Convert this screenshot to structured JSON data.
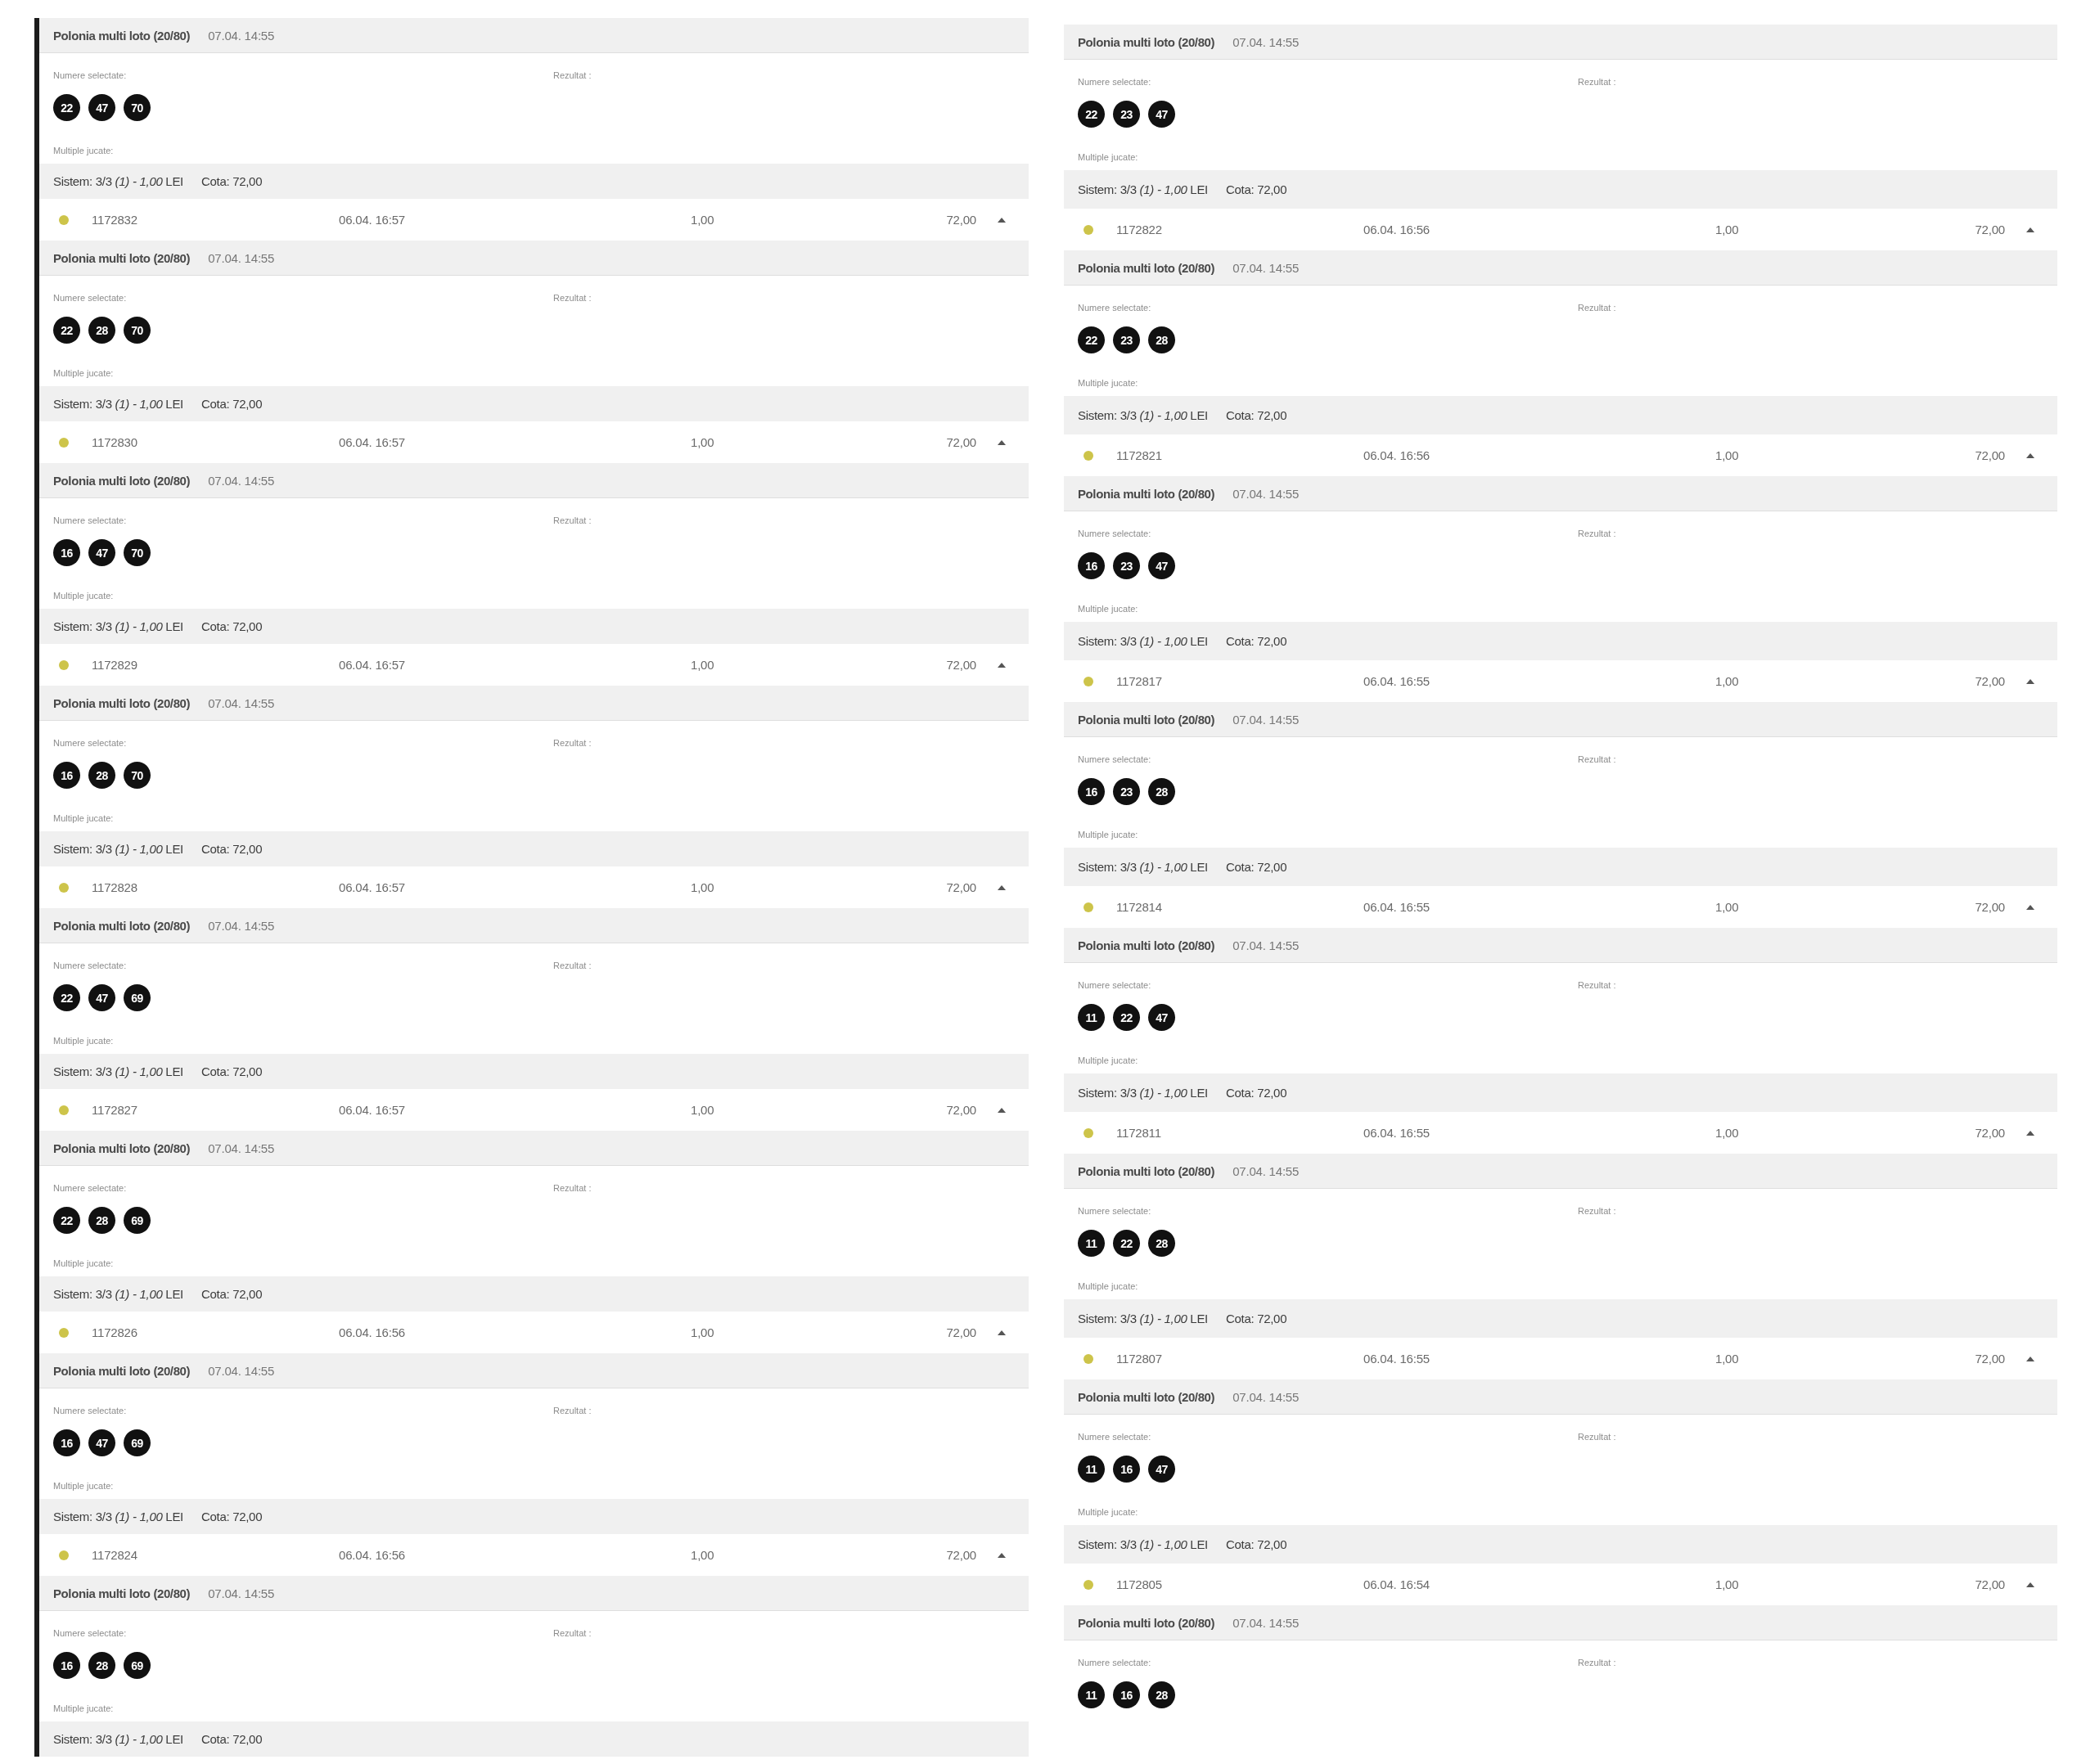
{
  "panels": [
    {
      "tickets": [
        {
          "details": {
            "game": "Polonia multi loto (20/80)",
            "draw_time": "07.04. 14:55",
            "numbers_label": "Numere selectate:",
            "numbers": [
              "22",
              "47",
              "70"
            ],
            "result_label": "Rezultat :",
            "multiples_label": "Multiple jucate:",
            "system": {
              "text": "Sistem: 3/3 *(1) - 1,00* LEI",
              "odds": "Cota: 72,00"
            }
          }
        },
        {
          "row": {
            "color": "#cdc44a",
            "id": "1172832",
            "time": "06.04. 16:57",
            "stake": "1,00",
            "win": "72,00",
            "expanded": true
          },
          "details": {
            "game": "Polonia multi loto (20/80)",
            "draw_time": "07.04. 14:55",
            "numbers_label": "Numere selectate:",
            "numbers": [
              "22",
              "28",
              "70"
            ],
            "result_label": "Rezultat :",
            "multiples_label": "Multiple jucate:",
            "system": {
              "text": "Sistem: 3/3 *(1) - 1,00* LEI",
              "odds": "Cota: 72,00"
            }
          }
        },
        {
          "row": {
            "color": "#cdc44a",
            "id": "1172830",
            "time": "06.04. 16:57",
            "stake": "1,00",
            "win": "72,00",
            "expanded": true
          },
          "details": {
            "game": "Polonia multi loto (20/80)",
            "draw_time": "07.04. 14:55",
            "numbers_label": "Numere selectate:",
            "numbers": [
              "16",
              "47",
              "70"
            ],
            "result_label": "Rezultat :",
            "multiples_label": "Multiple jucate:",
            "system": {
              "text": "Sistem: 3/3 *(1) - 1,00* LEI",
              "odds": "Cota: 72,00"
            }
          }
        },
        {
          "row": {
            "color": "#cdc44a",
            "id": "1172829",
            "time": "06.04. 16:57",
            "stake": "1,00",
            "win": "72,00",
            "expanded": true
          },
          "details": {
            "game": "Polonia multi loto (20/80)",
            "draw_time": "07.04. 14:55",
            "numbers_label": "Numere selectate:",
            "numbers": [
              "16",
              "28",
              "70"
            ],
            "result_label": "Rezultat :",
            "multiples_label": "Multiple jucate:",
            "system": {
              "text": "Sistem: 3/3 *(1) - 1,00* LEI",
              "odds": "Cota: 72,00"
            }
          }
        },
        {
          "row": {
            "color": "#cdc44a",
            "id": "1172828",
            "time": "06.04. 16:57",
            "stake": "1,00",
            "win": "72,00",
            "expanded": true
          },
          "details": {
            "game": "Polonia multi loto (20/80)",
            "draw_time": "07.04. 14:55",
            "numbers_label": "Numere selectate:",
            "numbers": [
              "22",
              "47",
              "69"
            ],
            "result_label": "Rezultat :",
            "multiples_label": "Multiple jucate:",
            "system": {
              "text": "Sistem: 3/3 *(1) - 1,00* LEI",
              "odds": "Cota: 72,00"
            }
          }
        },
        {
          "row": {
            "color": "#cdc44a",
            "id": "1172827",
            "time": "06.04. 16:57",
            "stake": "1,00",
            "win": "72,00",
            "expanded": true
          },
          "details": {
            "game": "Polonia multi loto (20/80)",
            "draw_time": "07.04. 14:55",
            "numbers_label": "Numere selectate:",
            "numbers": [
              "22",
              "28",
              "69"
            ],
            "result_label": "Rezultat :",
            "multiples_label": "Multiple jucate:",
            "system": {
              "text": "Sistem: 3/3 *(1) - 1,00* LEI",
              "odds": "Cota: 72,00"
            }
          }
        },
        {
          "row": {
            "color": "#cdc44a",
            "id": "1172826",
            "time": "06.04. 16:56",
            "stake": "1,00",
            "win": "72,00",
            "expanded": true
          },
          "details": {
            "game": "Polonia multi loto (20/80)",
            "draw_time": "07.04. 14:55",
            "numbers_label": "Numere selectate:",
            "numbers": [
              "16",
              "47",
              "69"
            ],
            "result_label": "Rezultat :",
            "multiples_label": "Multiple jucate:",
            "system": {
              "text": "Sistem: 3/3 *(1) - 1,00* LEI",
              "odds": "Cota: 72,00"
            }
          }
        },
        {
          "row": {
            "color": "#cdc44a",
            "id": "1172824",
            "time": "06.04. 16:56",
            "stake": "1,00",
            "win": "72,00",
            "expanded": true
          },
          "details": {
            "game": "Polonia multi loto (20/80)",
            "draw_time": "07.04. 14:55",
            "numbers_label": "Numere selectate:",
            "numbers": [
              "16",
              "28",
              "69"
            ],
            "result_label": "Rezultat :",
            "multiples_label": "Multiple jucate:",
            "system": {
              "text": "Sistem: 3/3 *(1) - 1,00* LEI",
              "odds": "Cota: 72,00"
            }
          }
        }
      ]
    },
    {
      "tickets": [
        {
          "details": {
            "game": "Polonia multi loto (20/80)",
            "draw_time": "07.04. 14:55",
            "numbers_label": "Numere selectate:",
            "numbers": [
              "22",
              "23",
              "47"
            ],
            "result_label": "Rezultat :",
            "multiples_label": "Multiple jucate:",
            "system": {
              "text": "Sistem: 3/3 *(1) - 1,00* LEI",
              "odds": "Cota: 72,00"
            }
          }
        },
        {
          "row": {
            "color": "#cdc44a",
            "id": "1172822",
            "time": "06.04. 16:56",
            "stake": "1,00",
            "win": "72,00",
            "expanded": true
          },
          "details": {
            "game": "Polonia multi loto (20/80)",
            "draw_time": "07.04. 14:55",
            "numbers_label": "Numere selectate:",
            "numbers": [
              "22",
              "23",
              "28"
            ],
            "result_label": "Rezultat :",
            "multiples_label": "Multiple jucate:",
            "system": {
              "text": "Sistem: 3/3 *(1) - 1,00* LEI",
              "odds": "Cota: 72,00"
            }
          }
        },
        {
          "row": {
            "color": "#cdc44a",
            "id": "1172821",
            "time": "06.04. 16:56",
            "stake": "1,00",
            "win": "72,00",
            "expanded": true
          },
          "details": {
            "game": "Polonia multi loto (20/80)",
            "draw_time": "07.04. 14:55",
            "numbers_label": "Numere selectate:",
            "numbers": [
              "16",
              "23",
              "47"
            ],
            "result_label": "Rezultat :",
            "multiples_label": "Multiple jucate:",
            "system": {
              "text": "Sistem: 3/3 *(1) - 1,00* LEI",
              "odds": "Cota: 72,00"
            }
          }
        },
        {
          "row": {
            "color": "#cdc44a",
            "id": "1172817",
            "time": "06.04. 16:55",
            "stake": "1,00",
            "win": "72,00",
            "expanded": true
          },
          "details": {
            "game": "Polonia multi loto (20/80)",
            "draw_time": "07.04. 14:55",
            "numbers_label": "Numere selectate:",
            "numbers": [
              "16",
              "23",
              "28"
            ],
            "result_label": "Rezultat :",
            "multiples_label": "Multiple jucate:",
            "system": {
              "text": "Sistem: 3/3 *(1) - 1,00* LEI",
              "odds": "Cota: 72,00"
            }
          }
        },
        {
          "row": {
            "color": "#cdc44a",
            "id": "1172814",
            "time": "06.04. 16:55",
            "stake": "1,00",
            "win": "72,00",
            "expanded": true
          },
          "details": {
            "game": "Polonia multi loto (20/80)",
            "draw_time": "07.04. 14:55",
            "numbers_label": "Numere selectate:",
            "numbers": [
              "11",
              "22",
              "47"
            ],
            "result_label": "Rezultat :",
            "multiples_label": "Multiple jucate:",
            "system": {
              "text": "Sistem: 3/3 *(1) - 1,00* LEI",
              "odds": "Cota: 72,00"
            }
          }
        },
        {
          "row": {
            "color": "#cdc44a",
            "id": "1172811",
            "time": "06.04. 16:55",
            "stake": "1,00",
            "win": "72,00",
            "expanded": true
          },
          "details": {
            "game": "Polonia multi loto (20/80)",
            "draw_time": "07.04. 14:55",
            "numbers_label": "Numere selectate:",
            "numbers": [
              "11",
              "22",
              "28"
            ],
            "result_label": "Rezultat :",
            "multiples_label": "Multiple jucate:",
            "system": {
              "text": "Sistem: 3/3 *(1) - 1,00* LEI",
              "odds": "Cota: 72,00"
            }
          }
        },
        {
          "row": {
            "color": "#cdc44a",
            "id": "1172807",
            "time": "06.04. 16:55",
            "stake": "1,00",
            "win": "72,00",
            "expanded": true
          },
          "details": {
            "game": "Polonia multi loto (20/80)",
            "draw_time": "07.04. 14:55",
            "numbers_label": "Numere selectate:",
            "numbers": [
              "11",
              "16",
              "47"
            ],
            "result_label": "Rezultat :",
            "multiples_label": "Multiple jucate:",
            "system": {
              "text": "Sistem: 3/3 *(1) - 1,00* LEI",
              "odds": "Cota: 72,00"
            }
          }
        },
        {
          "row": {
            "color": "#cdc44a",
            "id": "1172805",
            "time": "06.04. 16:54",
            "stake": "1,00",
            "win": "72,00",
            "expanded": true
          },
          "details": {
            "game": "Polonia multi loto (20/80)",
            "draw_time": "07.04. 14:55",
            "numbers_label": "Numere selectate:",
            "numbers": [
              "11",
              "16",
              "28"
            ],
            "result_label": "Rezultat :"
          }
        }
      ]
    }
  ]
}
